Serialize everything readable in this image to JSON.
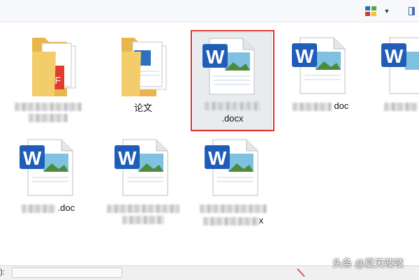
{
  "toolbar": {
    "view_icon": "change-view-icon",
    "dropdown_icon": "chevron-down-icon",
    "dropdown_glyph": "▼",
    "pane_icon": "preview-pane-icon",
    "colors": {
      "blue": "#1e73be",
      "green": "#5aa63a",
      "red": "#d8382b",
      "yellow": "#f2c230"
    }
  },
  "files": [
    {
      "kind": "folder-pdf",
      "name": "",
      "blurred": true
    },
    {
      "kind": "folder-doc",
      "name": "论文",
      "blurred": false
    },
    {
      "kind": "word",
      "name": ".docx",
      "blurred": true,
      "selected": true
    },
    {
      "kind": "word",
      "name": "doc",
      "blurred": true
    },
    {
      "kind": "word",
      "name": "",
      "blurred": true
    },
    {
      "kind": "word",
      "name": ".doc",
      "blurred": true
    },
    {
      "kind": "word",
      "name": "",
      "blurred": true
    },
    {
      "kind": "word",
      "name": "x",
      "blurred": true
    }
  ],
  "pdf_badge": "PDF",
  "word_letter": "W",
  "status": {
    "label": "):"
  },
  "watermark": "头条 @夏天吱吱",
  "colors": {
    "selection_border": "#e0312f",
    "word_blue": "#1f5db8",
    "folder_yellow": "#f3cd6b",
    "pdf_red": "#e23a2e"
  }
}
